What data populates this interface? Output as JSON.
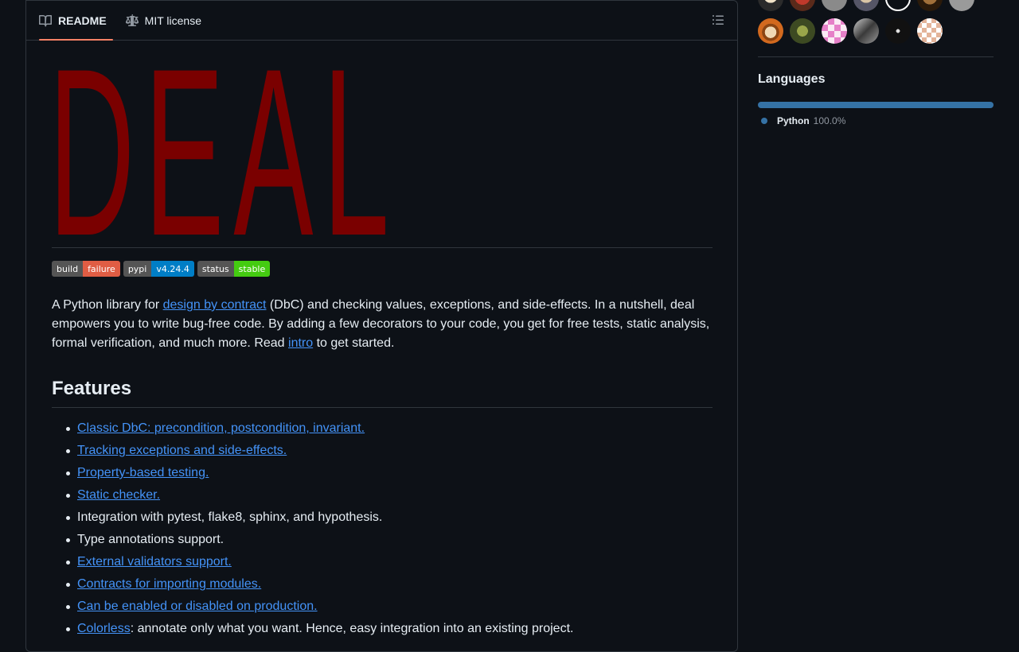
{
  "tabs": {
    "readme": "README",
    "license": "MIT license"
  },
  "logo": {
    "text": "DEAL",
    "color": "#7a0000"
  },
  "badges": [
    {
      "key": "build",
      "value": "failure",
      "color": "#e05d44"
    },
    {
      "key": "pypi",
      "value": "v4.24.4",
      "color": "#007ec6"
    },
    {
      "key": "status",
      "value": "stable",
      "color": "#4c1"
    }
  ],
  "intro": {
    "t1": "A Python library for ",
    "link1": "design by contract",
    "t2": " (DbC) and checking values, exceptions, and side-effects. In a nutshell, deal empowers you to write bug-free code. By adding a few decorators to your code, you get for free tests, static analysis, formal verification, and much more. Read ",
    "link2": "intro",
    "t3": " to get started."
  },
  "features": {
    "heading": "Features",
    "items": [
      {
        "link": "Classic DbC: precondition, postcondition, invariant.",
        "text": ""
      },
      {
        "link": "Tracking exceptions and side-effects.",
        "text": ""
      },
      {
        "link": "Property-based testing.",
        "text": ""
      },
      {
        "link": "Static checker.",
        "text": ""
      },
      {
        "link": "",
        "text": "Integration with pytest, flake8, sphinx, and hypothesis."
      },
      {
        "link": "",
        "text": "Type annotations support."
      },
      {
        "link": "External validators support.",
        "text": ""
      },
      {
        "link": "Contracts for importing modules.",
        "text": ""
      },
      {
        "link": "Can be enabled or disabled on production.",
        "text": ""
      },
      {
        "link": "Colorless",
        "text": ": annotate only what you want. Hence, easy integration into an existing project."
      }
    ]
  },
  "languages": {
    "title": "Languages",
    "items": [
      {
        "name": "Python",
        "percent": "100.0%",
        "color": "#3572a5"
      }
    ]
  },
  "colors": {
    "background": "#0d1117",
    "border": "#30363d",
    "link": "#4493f8",
    "tab_underline": "#f78166"
  }
}
